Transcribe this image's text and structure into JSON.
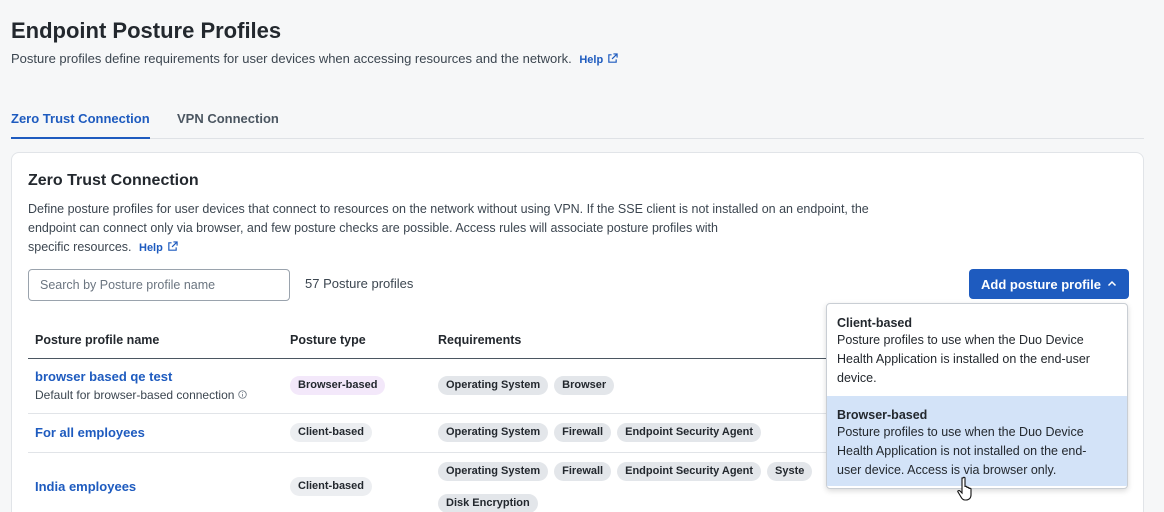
{
  "page": {
    "title": "Endpoint Posture Profiles",
    "description": "Posture profiles define requirements for user devices when accessing resources and the network.",
    "help_label": "Help"
  },
  "tabs": [
    {
      "label": "Zero Trust Connection",
      "active": true
    },
    {
      "label": "VPN Connection",
      "active": false
    }
  ],
  "section": {
    "title": "Zero Trust Connection",
    "description_lines": [
      "Define posture profiles for user devices that connect to resources on the network without using VPN. If the SSE client is not installed on an endpoint, the",
      "endpoint can connect only via browser, and few posture checks are possible. Access rules will associate posture profiles with",
      "specific resources."
    ],
    "help_label": "Help"
  },
  "search": {
    "placeholder": "Search by Posture profile name",
    "value": ""
  },
  "count_text": "57 Posture profiles",
  "add_button_label": "Add posture profile",
  "table": {
    "headers": [
      "Posture profile name",
      "Posture type",
      "Requirements"
    ],
    "rows": [
      {
        "name": "browser based qe test",
        "sub": "Default for browser-based connection",
        "type": "Browser-based",
        "requirements": [
          "Operating System",
          "Browser"
        ]
      },
      {
        "name": "For all employees",
        "sub": "",
        "type": "Client-based",
        "requirements": [
          "Operating System",
          "Firewall",
          "Endpoint Security Agent"
        ]
      },
      {
        "name": "India employees",
        "sub": "",
        "type": "Client-based",
        "requirements": [
          "Operating System",
          "Firewall",
          "Endpoint Security Agent",
          "Syste",
          "Disk Encryption"
        ]
      }
    ]
  },
  "dropdown": {
    "items": [
      {
        "title": "Client-based",
        "desc_lines": [
          "Posture profiles to use when the Duo Device",
          "Health Application is installed on the end-user",
          "device."
        ]
      },
      {
        "title": "Browser-based",
        "desc_lines": [
          "Posture profiles to use when the Duo Device",
          "Health Application is not installed on the end-",
          "user device. Access is via browser only."
        ]
      }
    ]
  },
  "colors": {
    "accent": "#1e5bbf",
    "hover_bg": "#d3e3f8",
    "browser_pill": "#f3e8fa",
    "req_pill": "#e3e6ea"
  },
  "icons": [
    "external-link-icon",
    "chevron-up-icon",
    "info-icon",
    "hand-cursor-icon"
  ]
}
